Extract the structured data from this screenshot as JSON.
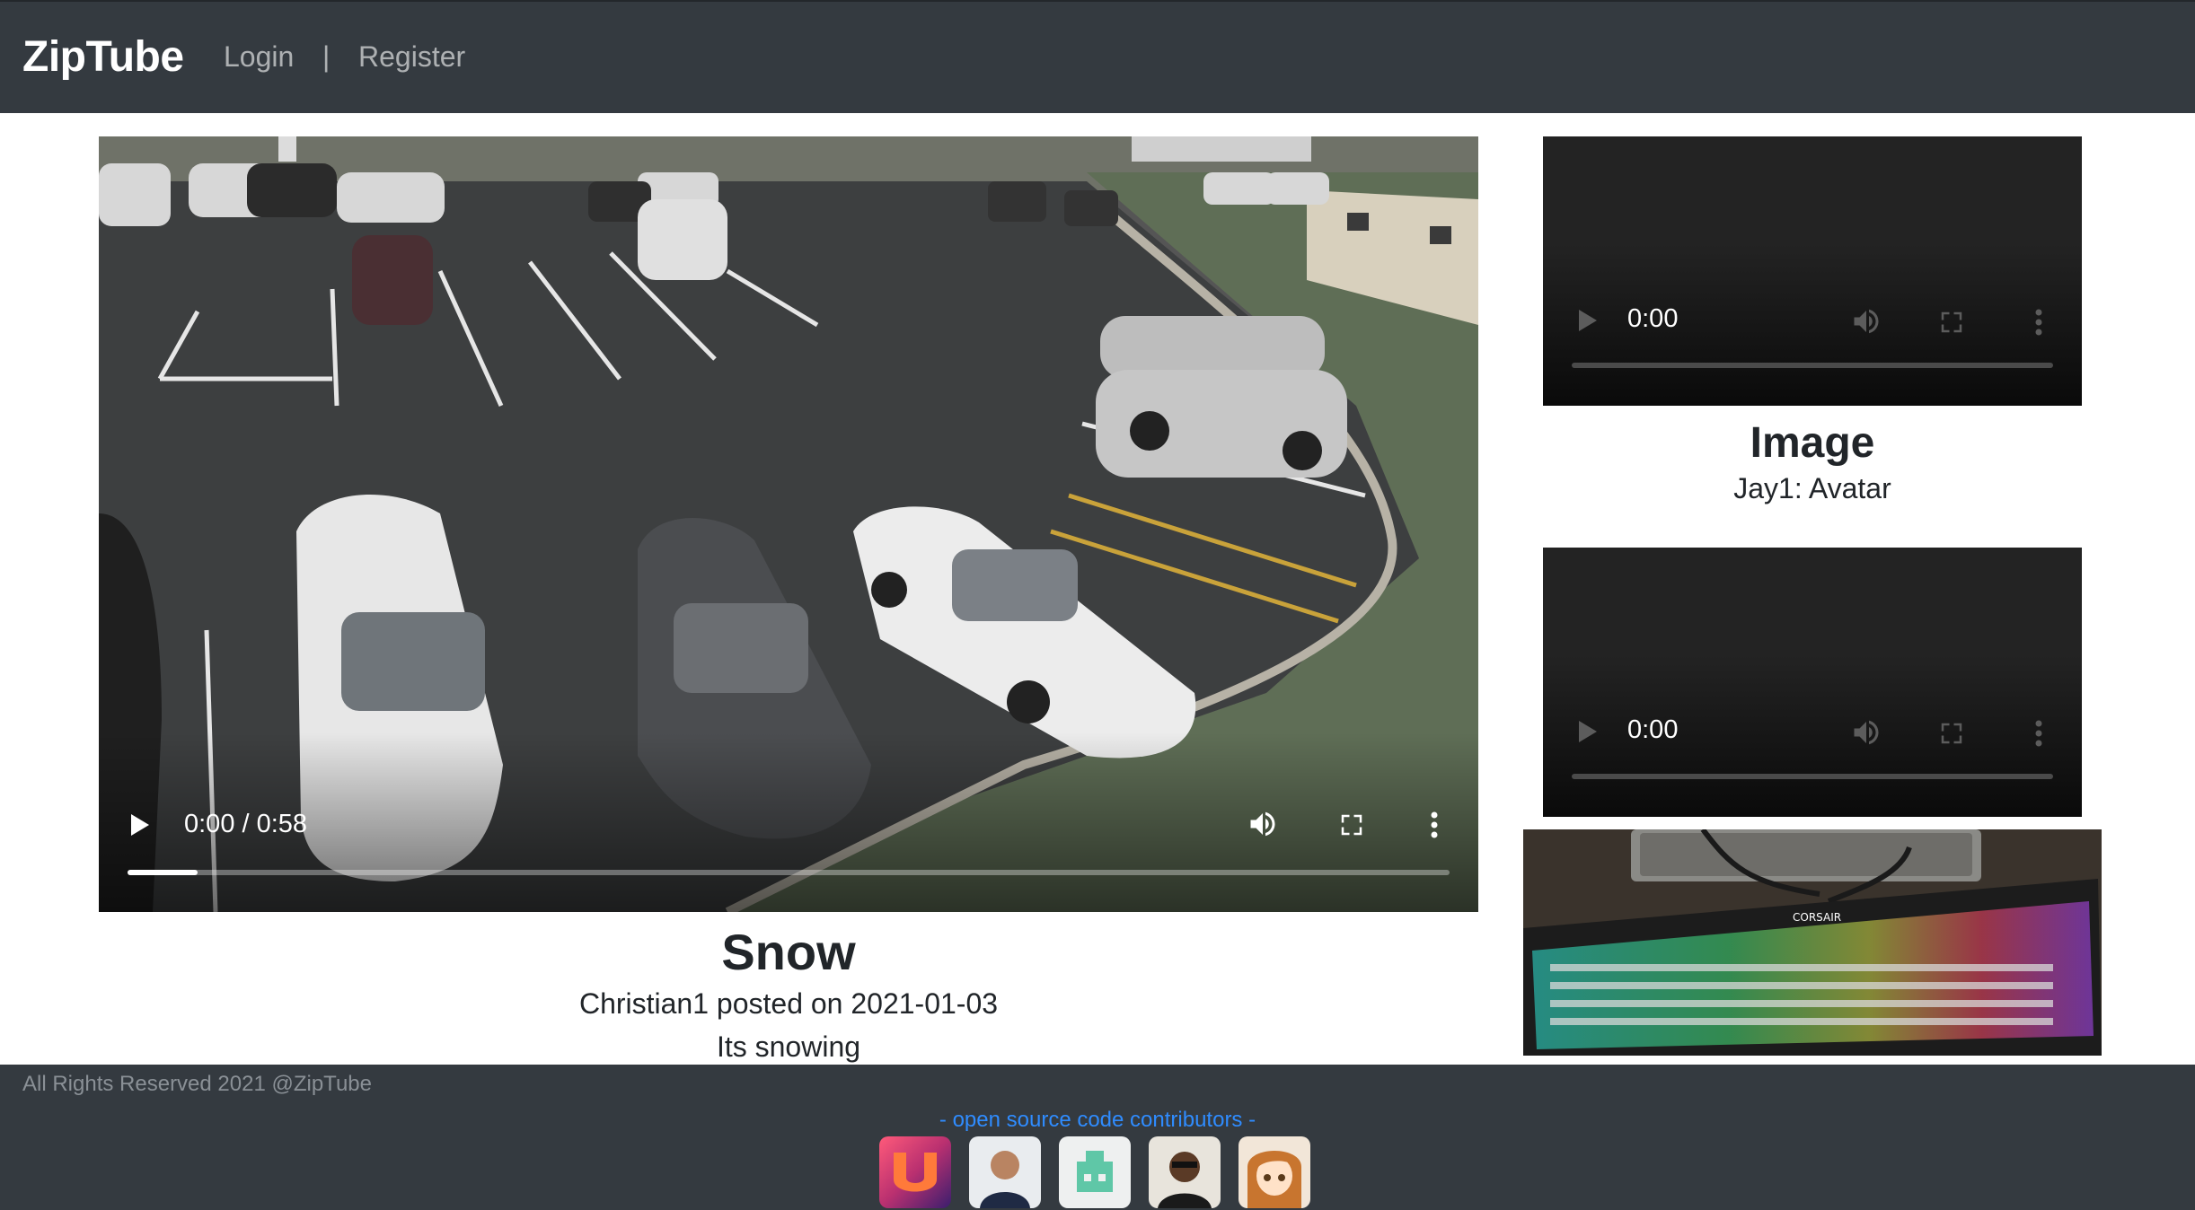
{
  "navbar": {
    "brand": "ZipTube",
    "login_label": "Login",
    "separator": "|",
    "register_label": "Register"
  },
  "main_post": {
    "title": "Snow",
    "meta": "Christian1 posted on 2021-01-03",
    "description": "Its snowing",
    "video": {
      "time_display": "0:00 / 0:58",
      "progress_fraction": 0.053,
      "icons": [
        "play-icon",
        "volume-icon",
        "fullscreen-icon",
        "more-options-icon"
      ]
    }
  },
  "sidebar": {
    "items": [
      {
        "time_display": "0:00",
        "title": "Image",
        "meta": "Jay1: Avatar"
      },
      {
        "time_display": "0:00"
      }
    ]
  },
  "footer": {
    "copyright": "All Rights Reserved 2021 @ZipTube",
    "contributors_label": "- open source code contributors -",
    "contributor_avatars": [
      "contributor-avatar-1",
      "contributor-avatar-2",
      "contributor-avatar-3",
      "contributor-avatar-4",
      "contributor-avatar-5"
    ]
  },
  "colors": {
    "navbar_bg": "#343a40",
    "footer_bg": "#343a40",
    "link_blue": "#2f8cff",
    "text_dark": "#212529"
  }
}
